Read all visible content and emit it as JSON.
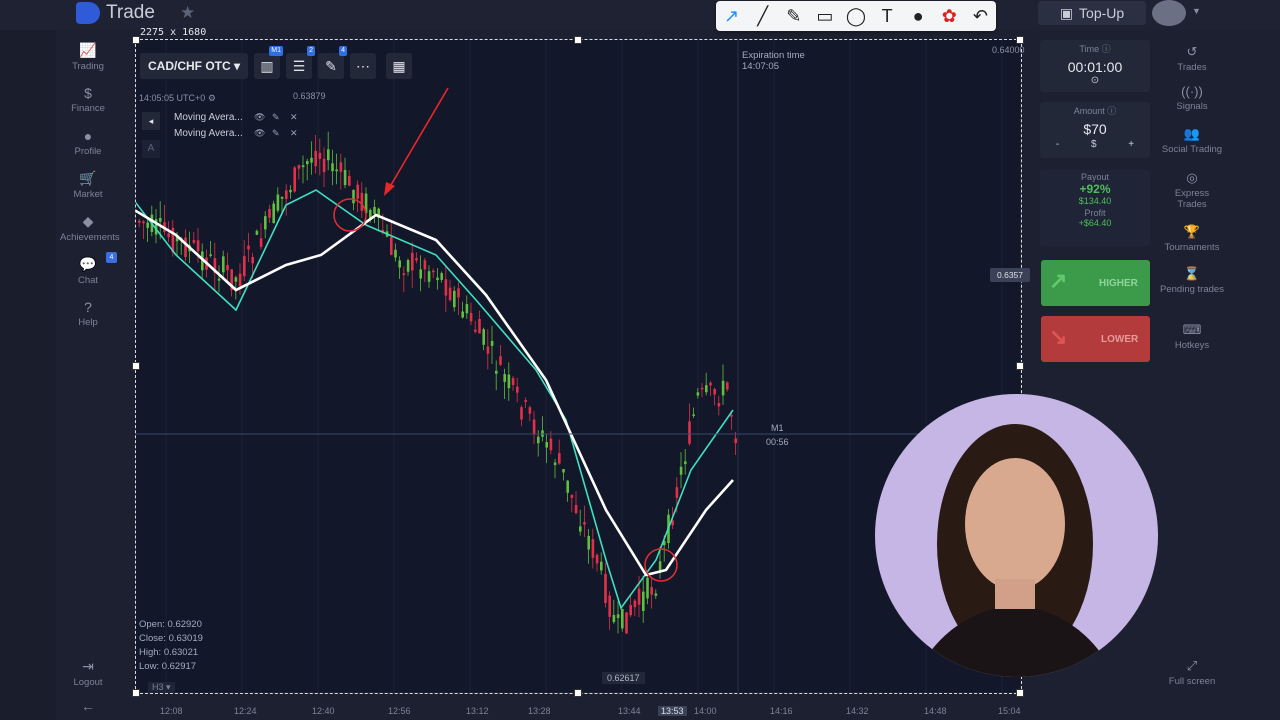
{
  "app": {
    "title": "Trade"
  },
  "header": {
    "topup_label": "Top-Up"
  },
  "selection": {
    "dimensions": "2275 x 1680"
  },
  "left_nav": [
    {
      "id": "trading",
      "label": "Trading",
      "icon": "chart-icon"
    },
    {
      "id": "finance",
      "label": "Finance",
      "icon": "dollar-icon"
    },
    {
      "id": "profile",
      "label": "Profile",
      "icon": "person-icon"
    },
    {
      "id": "market",
      "label": "Market",
      "icon": "cart-icon"
    },
    {
      "id": "achievements",
      "label": "Achievements",
      "icon": "diamond-icon"
    },
    {
      "id": "chat",
      "label": "Chat",
      "icon": "chat-icon",
      "badge": "4"
    },
    {
      "id": "help",
      "label": "Help",
      "icon": "help-icon"
    }
  ],
  "logout_label": "Logout",
  "chart_toolbar": {
    "pair": "CAD/CHF OTC",
    "badges": [
      "M1",
      "2",
      "4"
    ]
  },
  "chart_info": {
    "time": "14:05:05 UTC+0",
    "top_price": "0.63879",
    "indicators": [
      "Moving Avera...",
      "Moving Avera..."
    ],
    "expiration_label": "Expiration time",
    "expiration_time": "14:07:05",
    "current_price": "0.6357",
    "timeframe": "M1",
    "countdown": "00:56",
    "low_price": "0.62617",
    "right_top": "0.64000",
    "ohlc": {
      "open": "Open: 0.62920",
      "close": "Close: 0.63019",
      "high": "High: 0.63021",
      "low": "Low: 0.62917"
    },
    "ha_label": "H3"
  },
  "time_axis": [
    "12:08",
    "12:24",
    "12:40",
    "12:56",
    "13:12",
    "13:28",
    "13:44",
    "13:53",
    "14:00",
    "14:16",
    "14:32",
    "14:48",
    "15:04"
  ],
  "trade_panel": {
    "time_label": "Time",
    "time_value": "00:01:00",
    "amount_label": "Amount",
    "amount_value": "$70",
    "minus": "-",
    "currency": "$",
    "plus": "+",
    "payout_label": "Payout",
    "payout_percent": "+92%",
    "payout_amount": "$134.40",
    "profit_label": "Profit",
    "profit_value": "+$64.40",
    "higher_label": "HIGHER",
    "lower_label": "LOWER"
  },
  "right_nav": [
    {
      "id": "trades",
      "label": "Trades",
      "icon": "history-icon"
    },
    {
      "id": "signals",
      "label": "Signals",
      "icon": "signal-icon"
    },
    {
      "id": "social",
      "label": "Social Trading",
      "icon": "people-icon"
    },
    {
      "id": "express",
      "label": "Express Trades",
      "icon": "express-icon"
    },
    {
      "id": "tournaments",
      "label": "Tournaments",
      "icon": "trophy-icon"
    },
    {
      "id": "pending",
      "label": "Pending trades",
      "icon": "hourglass-icon"
    },
    {
      "id": "hotkeys",
      "label": "Hotkeys",
      "icon": "keyboard-icon"
    }
  ],
  "fullscreen_label": "Full screen",
  "colors": {
    "bull": "#5fbf3f",
    "bear": "#e0304a",
    "ma_fast": "#3fe0c0",
    "ma_slow": "#ffffff",
    "accent": "#2f6fe4"
  }
}
